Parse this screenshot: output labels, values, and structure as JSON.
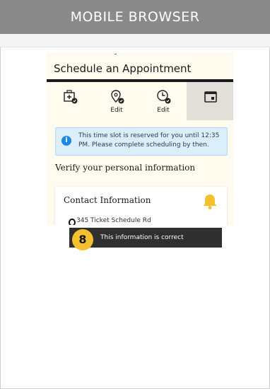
{
  "header": {
    "title": "MOBILE BROWSER"
  },
  "app": {
    "title": "Schedule an Appointment",
    "steps": [
      {
        "icon": "clinic-icon",
        "label": ""
      },
      {
        "icon": "location-icon",
        "label": "Edit"
      },
      {
        "icon": "clock-icon",
        "label": "Edit"
      },
      {
        "icon": "calendar-icon",
        "label": ""
      }
    ],
    "notice": "This time slot is reserved for you until 12:35 PM. Please complete scheduling by then.",
    "verify_heading": "Verify your personal information",
    "card": {
      "title": "Contact Information",
      "address": "345 Ticket Schedule Rd"
    }
  },
  "callout": {
    "step_number": "8",
    "message": "This information is correct"
  }
}
